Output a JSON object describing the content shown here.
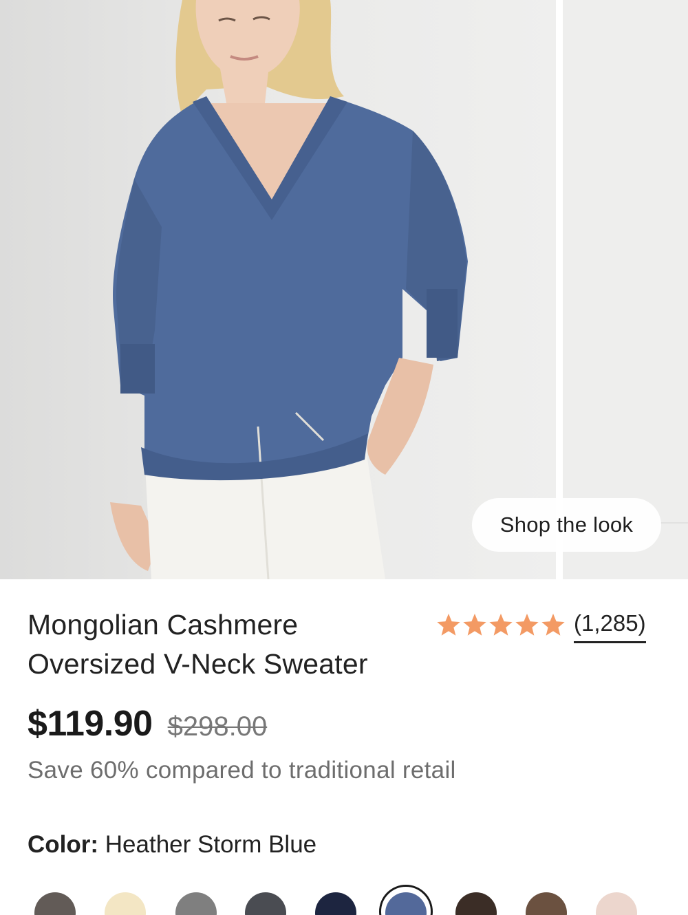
{
  "gallery": {
    "shop_the_look_label": "Shop the look"
  },
  "product": {
    "title_line1": "Mongolian Cashmere",
    "title_line2": "Oversized V-Neck Sweater",
    "rating_stars": 5,
    "review_count": "(1,285)",
    "price": "$119.90",
    "original_price": "$298.00",
    "savings_text": "Save 60% compared to traditional retail",
    "color_label": "Color:",
    "color_value": "Heather Storm Blue"
  },
  "colors": {
    "star": "#f39a64",
    "sweater": "#4f6b9c",
    "accent_text": "#222222"
  },
  "swatches": [
    {
      "name": "swatch-taupe",
      "color": "#625b57"
    },
    {
      "name": "swatch-cream",
      "color": "#f3e6c4"
    },
    {
      "name": "swatch-grey",
      "color": "#7f7f7f"
    },
    {
      "name": "swatch-charcoal",
      "color": "#4a4c52"
    },
    {
      "name": "swatch-navy",
      "color": "#1d2540"
    },
    {
      "name": "swatch-heather-storm-blue",
      "color": "#53699a",
      "selected": true
    },
    {
      "name": "swatch-espresso",
      "color": "#3b2d26"
    },
    {
      "name": "swatch-brown",
      "color": "#6b5140"
    },
    {
      "name": "swatch-blush",
      "color": "#ecd6cd"
    }
  ]
}
